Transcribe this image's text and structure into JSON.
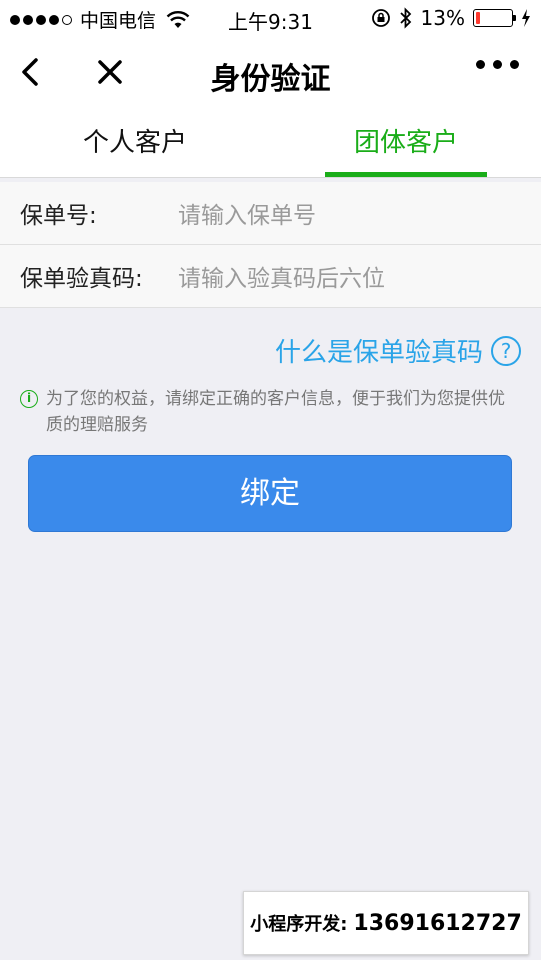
{
  "status_bar": {
    "carrier": "中国电信",
    "time": "上午9:31",
    "battery_percent": "13%",
    "battery_level": 0.13
  },
  "nav": {
    "title": "身份验证",
    "back_icon": "chevron-left-icon",
    "close_icon": "close-icon",
    "more_icon": "more-dots-icon"
  },
  "tabs": [
    {
      "label": "个人客户",
      "active": false
    },
    {
      "label": "团体客户",
      "active": true
    }
  ],
  "form": {
    "policy_no": {
      "label": "保单号:",
      "placeholder": "请输入保单号"
    },
    "verify_code": {
      "label": "保单验真码:",
      "placeholder": "请输入验真码后六位"
    }
  },
  "help_link": {
    "text": "什么是保单验真码",
    "icon": "question-circle-icon"
  },
  "notice": {
    "icon": "info-icon",
    "text": "为了您的权益，请绑定正确的客户信息，便于我们为您提供优质的理赔服务"
  },
  "bind_button": {
    "label": "绑定"
  },
  "promo": {
    "label": "小程序开发:",
    "number": "13691612727"
  },
  "colors": {
    "accent_green": "#1aad19",
    "link_blue": "#2aa4e8",
    "button_blue": "#3a8aeb",
    "background": "#efeff4"
  }
}
